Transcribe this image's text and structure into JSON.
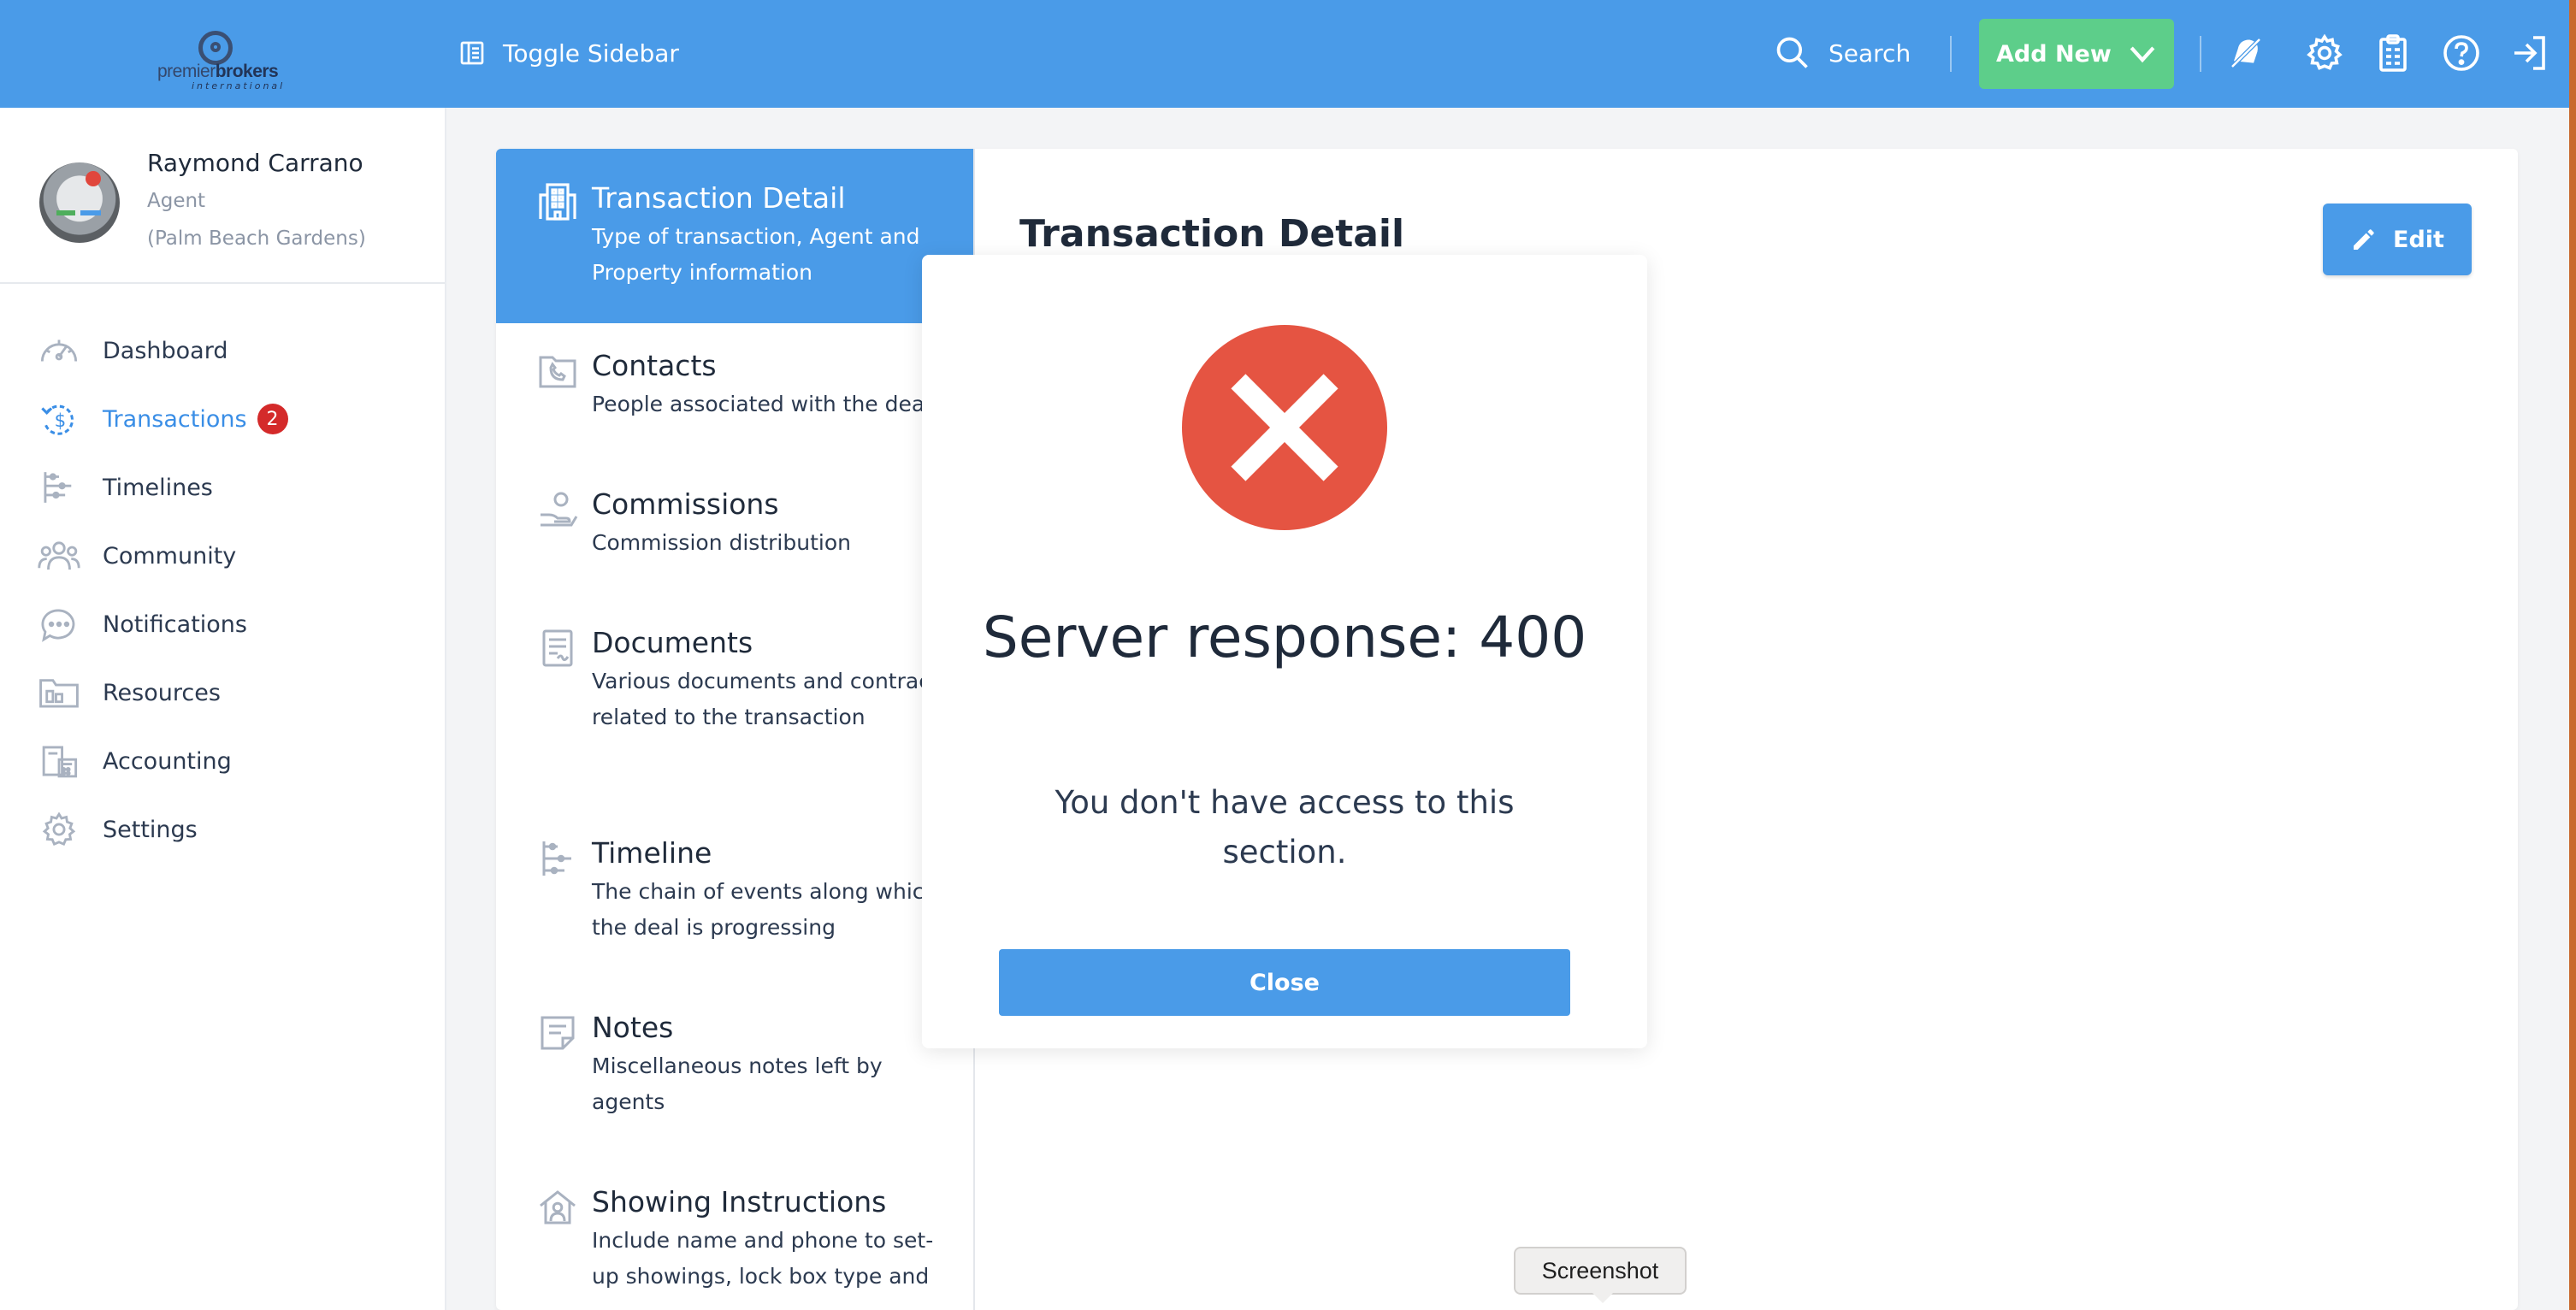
{
  "header": {
    "logo": {
      "word_light": "premier",
      "word_bold": "brokers",
      "sub": "international"
    },
    "toggle_sidebar": "Toggle Sidebar",
    "search": "Search",
    "add_new": "Add New",
    "icons": [
      "bell-off-icon",
      "gear-icon",
      "clipboard-icon",
      "help-icon",
      "logout-icon"
    ],
    "accent_color": "#4a9be8",
    "add_new_color": "#5dce8a"
  },
  "user": {
    "name": "Raymond Carrano",
    "role": "Agent",
    "location": "(Palm Beach Gardens)"
  },
  "sidebar": {
    "items": [
      {
        "label": "Dashboard",
        "icon": "speedometer-icon"
      },
      {
        "label": "Transactions",
        "icon": "dollar-cycle-icon",
        "badge": "2",
        "active": true
      },
      {
        "label": "Timelines",
        "icon": "timeline-icon"
      },
      {
        "label": "Community",
        "icon": "people-icon"
      },
      {
        "label": "Notifications",
        "icon": "chat-bubble-icon"
      },
      {
        "label": "Resources",
        "icon": "folder-icon"
      },
      {
        "label": "Accounting",
        "icon": "calculator-icon"
      },
      {
        "label": "Settings",
        "icon": "gear-icon"
      }
    ]
  },
  "tabs": [
    {
      "title": "Transaction Detail",
      "desc": "Type of transaction, Agent and Property information",
      "icon": "building-icon",
      "active": true
    },
    {
      "title": "Contacts",
      "desc": "People associated with the deal",
      "icon": "phone-book-icon"
    },
    {
      "title": "Commissions",
      "desc": "Commission distribution",
      "icon": "hand-coin-icon"
    },
    {
      "title": "Documents",
      "desc": "Various documents and contracts related to the transaction",
      "icon": "document-icon"
    },
    {
      "title": "Timeline",
      "desc": "The chain of events along which the deal is progressing",
      "icon": "timeline-icon"
    },
    {
      "title": "Notes",
      "desc": "Miscellaneous notes left by agents",
      "icon": "note-icon"
    },
    {
      "title": "Showing Instructions",
      "desc": "Include name and phone to set-up showings, lock box type and",
      "icon": "house-person-icon"
    }
  ],
  "panel": {
    "title": "Transaction Detail",
    "edit": "Edit"
  },
  "modal": {
    "title": "Server response: 400",
    "message": "You don't have access to this section.",
    "close": "Close",
    "error_color": "#e55442"
  },
  "tooltip": "Screenshot"
}
